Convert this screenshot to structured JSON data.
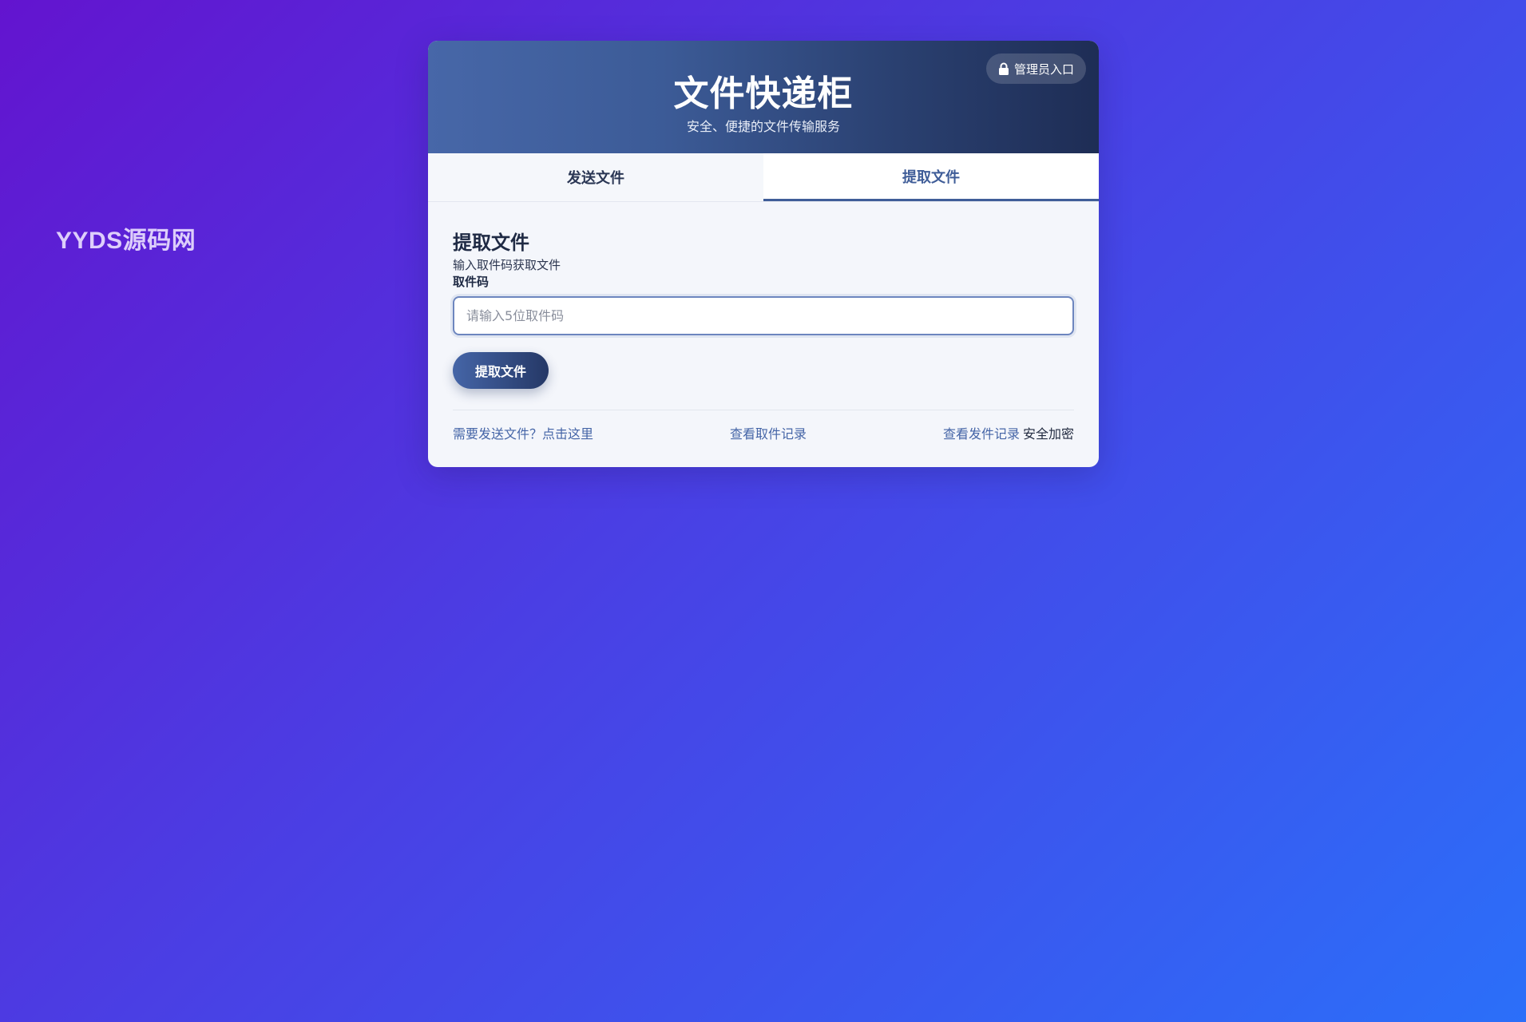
{
  "watermark": "YYDS源码网",
  "header": {
    "title": "文件快递柜",
    "subtitle": "安全、便捷的文件传输服务",
    "admin_label": "管理员入口"
  },
  "tabs": [
    {
      "label": "发送文件",
      "active": false
    },
    {
      "label": "提取文件",
      "active": true
    }
  ],
  "panel": {
    "title": "提取文件",
    "description": "输入取件码获取文件",
    "field_label": "取件码",
    "input_value": "",
    "input_placeholder": "请输入5位取件码",
    "submit_label": "提取文件"
  },
  "footer": {
    "send_link": "需要发送文件？点击这里",
    "pickup_history": "查看取件记录",
    "send_history": "查看发件记录",
    "secure_text": "安全加密"
  },
  "colors": {
    "accent": "#3f5d98",
    "link": "#4565a7",
    "background_start": "#6314cf",
    "background_end": "#2b6ff9"
  },
  "icons": {
    "admin": "lock-icon"
  }
}
